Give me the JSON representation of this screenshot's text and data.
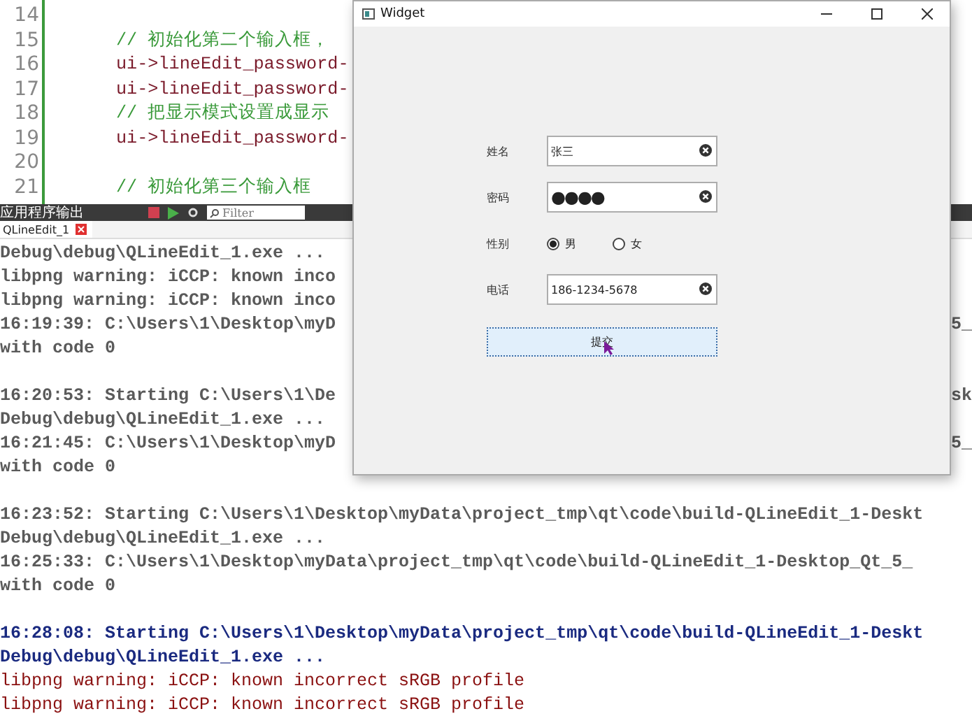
{
  "editor": {
    "lines": [
      {
        "number": "14",
        "kind": "empty"
      },
      {
        "number": "15",
        "kind": "comment",
        "text": "// 初始化第二个输入框，"
      },
      {
        "number": "16",
        "kind": "code",
        "text": "ui->lineEdit_password-"
      },
      {
        "number": "17",
        "kind": "code",
        "text": "ui->lineEdit_password-"
      },
      {
        "number": "18",
        "kind": "comment",
        "text": "// 把显示模式设置成显示"
      },
      {
        "number": "19",
        "kind": "code",
        "text": "ui->lineEdit_password-"
      },
      {
        "number": "20",
        "kind": "empty"
      },
      {
        "number": "21",
        "kind": "comment",
        "text": "// 初始化第三个输入框"
      }
    ]
  },
  "output_pane": {
    "title": "应用程序输出",
    "filter": {
      "placeholder": "Filter"
    },
    "tab": "QLineEdit_1",
    "rows": [
      {
        "kind": "info",
        "text": "Debug\\debug\\QLineEdit_1.exe ..."
      },
      {
        "kind": "info",
        "text": "libpng warning: iCCP: known inco"
      },
      {
        "kind": "info",
        "text": "libpng warning: iCCP: known inco"
      },
      {
        "kind": "info",
        "text": "16:19:39: C:\\Users\\1\\Desktop\\myD",
        "tail": "5_"
      },
      {
        "kind": "info",
        "text": "with code 0"
      },
      {
        "kind": "blank"
      },
      {
        "kind": "info",
        "text": "16:20:53: Starting C:\\Users\\1\\De",
        "tail": "sk"
      },
      {
        "kind": "info",
        "text": "Debug\\debug\\QLineEdit_1.exe ..."
      },
      {
        "kind": "info",
        "text": "16:21:45: C:\\Users\\1\\Desktop\\myD",
        "tail": "5_"
      },
      {
        "kind": "info",
        "text": "with code 0"
      },
      {
        "kind": "blank"
      },
      {
        "kind": "info",
        "text": "16:23:52: Starting C:\\Users\\1\\Desktop\\myData\\project_tmp\\qt\\code\\build-QLineEdit_1-Deskt"
      },
      {
        "kind": "info",
        "text": "Debug\\debug\\QLineEdit_1.exe ..."
      },
      {
        "kind": "info",
        "text": "16:25:33: C:\\Users\\1\\Desktop\\myData\\project_tmp\\qt\\code\\build-QLineEdit_1-Desktop_Qt_5_"
      },
      {
        "kind": "info",
        "text": "with code 0"
      },
      {
        "kind": "blank"
      },
      {
        "kind": "highlight",
        "text": "16:28:08: Starting C:\\Users\\1\\Desktop\\myData\\project_tmp\\qt\\code\\build-QLineEdit_1-Deskt"
      },
      {
        "kind": "highlight",
        "text": "Debug\\debug\\QLineEdit_1.exe ..."
      },
      {
        "kind": "warning",
        "text": "libpng warning: iCCP: known incorrect sRGB profile"
      },
      {
        "kind": "warning",
        "text": "libpng warning: iCCP: known incorrect sRGB profile"
      }
    ]
  },
  "window": {
    "title": "Widget",
    "form": [
      {
        "kind": "text",
        "label": "姓名",
        "value": "张三"
      },
      {
        "kind": "password",
        "label": "密码",
        "value": "●●●●"
      },
      {
        "kind": "radio",
        "label": "性别",
        "options": [
          {
            "label": "男",
            "selected": true
          },
          {
            "label": "女",
            "selected": false
          }
        ]
      },
      {
        "kind": "text",
        "label": "电话",
        "value": "186-1234-5678"
      }
    ],
    "button": "提交"
  }
}
